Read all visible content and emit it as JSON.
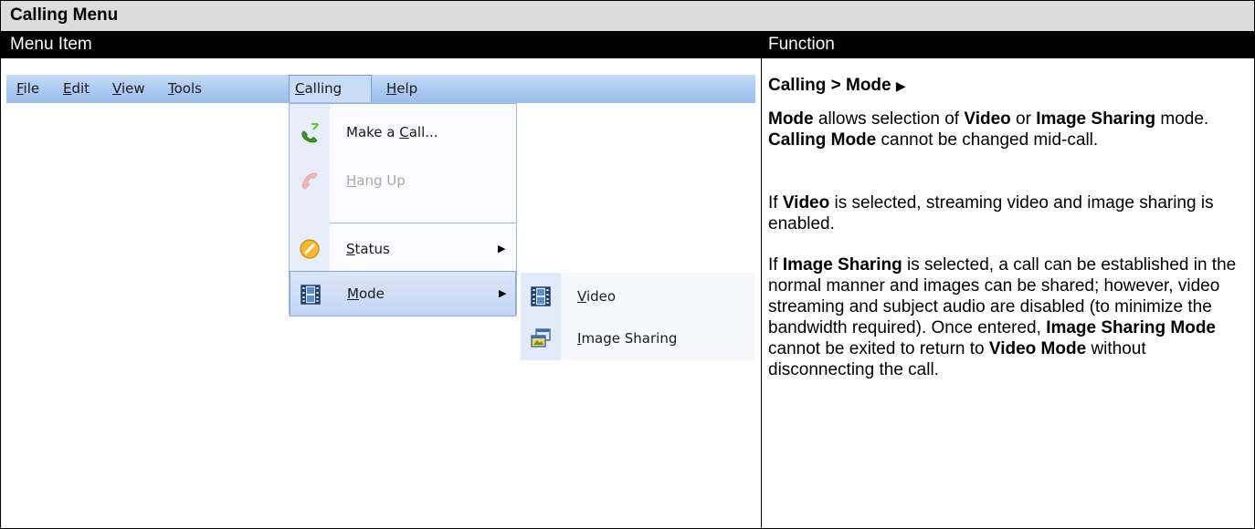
{
  "table": {
    "title": "Calling Menu",
    "col_menu_item": "Menu Item",
    "col_function": "Function"
  },
  "menubar": {
    "items": [
      {
        "label": "File",
        "mnemonic": "F",
        "rest": "ile"
      },
      {
        "label": "Edit",
        "mnemonic": "E",
        "rest": "dit"
      },
      {
        "label": "View",
        "mnemonic": "V",
        "rest": "iew"
      },
      {
        "label": "Tools",
        "mnemonic": "T",
        "rest": "ools"
      },
      {
        "label": "Calling",
        "mnemonic": "C",
        "rest": "alling"
      },
      {
        "label": "Help",
        "mnemonic": "H",
        "rest": "elp"
      }
    ]
  },
  "calling_menu": {
    "items": [
      {
        "pre": "Make a ",
        "mnemonic": "C",
        "post": "all...",
        "icon": "phone-green-icon"
      },
      {
        "pre": "",
        "mnemonic": "H",
        "post": "ang Up",
        "icon": "phone-hangup-icon"
      },
      {
        "pre": "",
        "mnemonic": "S",
        "post": "tatus",
        "icon": "status-icon"
      },
      {
        "pre": "",
        "mnemonic": "M",
        "post": "ode",
        "icon": "film-icon"
      }
    ]
  },
  "mode_submenu": {
    "items": [
      {
        "pre": "",
        "mnemonic": "V",
        "post": "ideo",
        "icon": "film-icon"
      },
      {
        "pre": "",
        "mnemonic": "I",
        "post": "mage Sharing",
        "icon": "image-sharing-icon"
      }
    ]
  },
  "function": {
    "heading_text": "Calling > Mode",
    "heading_arrow": "▶",
    "p1": {
      "a": "Mode",
      "b": " allows selection of ",
      "c": "Video",
      "d": " or ",
      "e": "Image Sharing",
      "f": " mode. ",
      "g": "Calling Mode",
      "h": " cannot be changed mid-call."
    },
    "p2": {
      "a": "If ",
      "b": "Video",
      "c": " is selected, streaming video and image sharing is enabled."
    },
    "p3": {
      "a": "If ",
      "b": "Image Sharing",
      "c": " is selected, a call can be established in the normal manner and images can be shared; however, video streaming and subject audio are disabled (to minimize the bandwidth required). Once entered, ",
      "d": "Image Sharing Mode",
      "e": " cannot be exited to return to ",
      "f": "Video Mode",
      "g": " without disconnecting the call."
    }
  }
}
